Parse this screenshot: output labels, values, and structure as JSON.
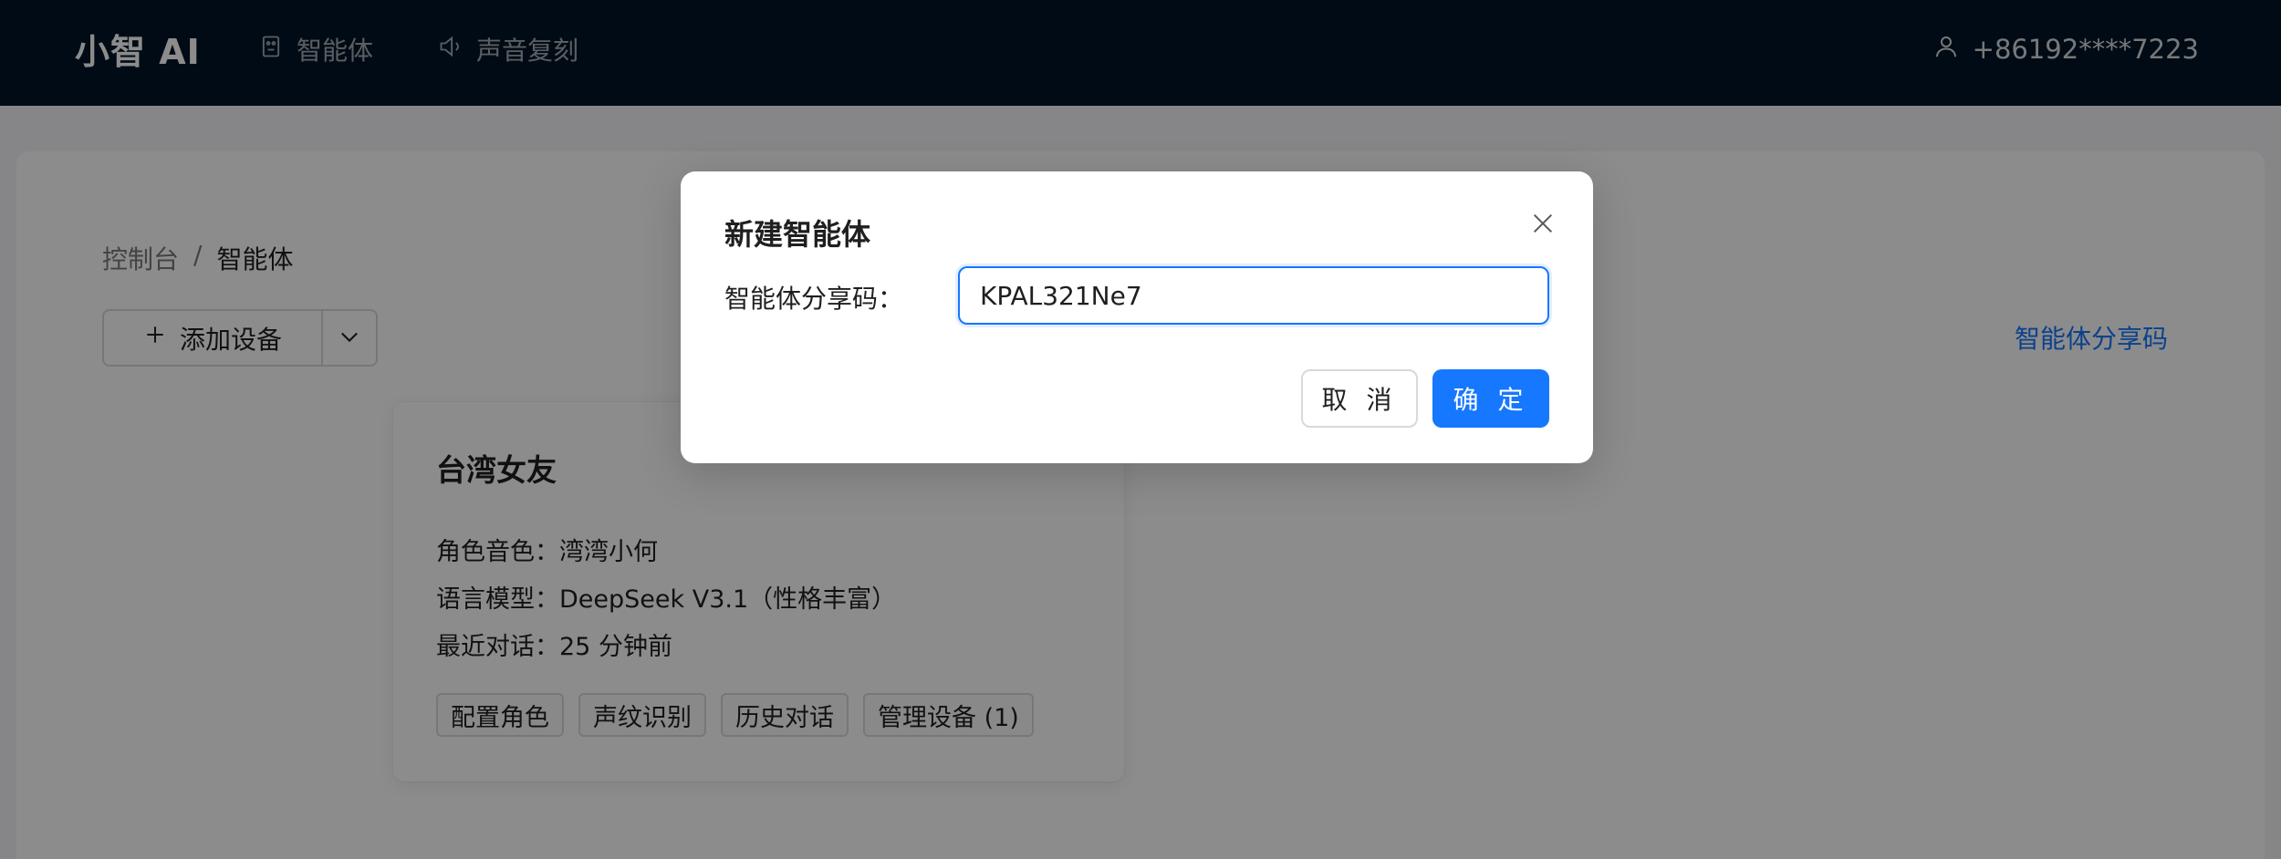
{
  "header": {
    "brand": "小智 AI",
    "nav": [
      {
        "label": "智能体",
        "icon": "robot-icon"
      },
      {
        "label": "声音复刻",
        "icon": "speaker-icon"
      }
    ],
    "user": {
      "phone": "+86192****7223",
      "icon": "user-icon"
    }
  },
  "breadcrumb": {
    "items": [
      "控制台",
      "智能体"
    ],
    "separator": "/"
  },
  "toolbar": {
    "add_device_label": "添加设备",
    "share_code_link": "智能体分享码"
  },
  "agent_card": {
    "title": "台湾女友",
    "voice_label": "角色音色：",
    "voice_value": "湾湾小何",
    "model_label": "语言模型：",
    "model_value": "DeepSeek V3.1（性格丰富）",
    "last_chat_label": "最近对话：",
    "last_chat_value": "25 分钟前",
    "actions": [
      "配置角色",
      "声纹识别",
      "历史对话",
      "管理设备 (1)"
    ]
  },
  "modal": {
    "title": "新建智能体",
    "field_label": "智能体分享码：",
    "field_value": "KPAL321Ne7",
    "cancel_label": "取 消",
    "confirm_label": "确 定"
  },
  "colors": {
    "header_bg": "#011427",
    "primary": "#1677ff",
    "mask": "rgba(0,0,0,0.45)"
  }
}
